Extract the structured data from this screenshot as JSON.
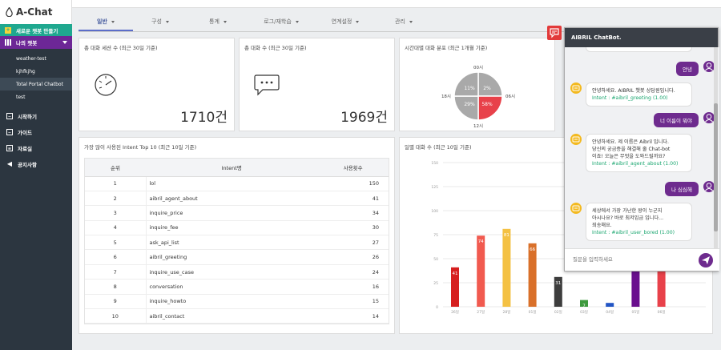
{
  "app": {
    "title": "A-Chat"
  },
  "sidebar": {
    "new_bot": "새로운 챗봇 만들기",
    "my_bots": "나의 챗봇",
    "bots": [
      "weather-test",
      "kjhfkjhg",
      "Total Portal Chatbot",
      "test"
    ],
    "nav": [
      {
        "label": "시작하기",
        "icon": "minus-box-icon"
      },
      {
        "label": "가이드",
        "icon": "minus-box-icon"
      },
      {
        "label": "자료실",
        "icon": "document-icon"
      },
      {
        "label": "공지사항",
        "icon": "megaphone-icon"
      }
    ]
  },
  "tabs": [
    "일반",
    "구성",
    "통계",
    "로그/재학습",
    "연계설정",
    "관리"
  ],
  "cards": {
    "sessions": {
      "title": "총 대화 세션 수 (최근 30일 기준)",
      "value": "1710건"
    },
    "dialogs": {
      "title": "총 대화 수 (최근 30일 기준)",
      "value": "1969건"
    },
    "time_dist": {
      "title": "시간대별 대화 분포 (최근 1개월 기준)"
    },
    "intent_top": {
      "title": "가장 많이 사용된 Intent Top 10 (최근 10일 기준)"
    },
    "daily": {
      "title": "일별 대화 수 (최근 10일 기준)"
    }
  },
  "intent_table": {
    "headers": [
      "순위",
      "Intent명",
      "사용횟수"
    ],
    "rows": [
      [
        "1",
        "lol",
        "150"
      ],
      [
        "2",
        "aibril_agent_about",
        "41"
      ],
      [
        "3",
        "inquire_price",
        "34"
      ],
      [
        "4",
        "inquire_fee",
        "30"
      ],
      [
        "5",
        "ask_api_list",
        "27"
      ],
      [
        "6",
        "aibril_greeting",
        "26"
      ],
      [
        "7",
        "inquire_use_case",
        "24"
      ],
      [
        "8",
        "conversation",
        "16"
      ],
      [
        "9",
        "inquire_howto",
        "15"
      ],
      [
        "10",
        "aibril_contact",
        "14"
      ]
    ]
  },
  "chart_data": [
    {
      "type": "pie",
      "title": "시간대별 대화 분포 (최근 1개월 기준)",
      "categories": [
        "00시-06시",
        "06시-12시",
        "12시-18시",
        "18시-00시"
      ],
      "values": [
        2,
        58,
        29,
        11
      ],
      "tick_labels": [
        "00시",
        "06시",
        "12시",
        "18시"
      ],
      "colors": [
        "#a9a9a9",
        "#e8414a",
        "#a9a9a9",
        "#a9a9a9"
      ]
    },
    {
      "type": "bar",
      "title": "일별 대화 수 (최근 10일 기준)",
      "ylim": [
        0,
        150
      ],
      "yticks": [
        0,
        25,
        50,
        75,
        100,
        125,
        150
      ],
      "categories": [
        "26일",
        "27일",
        "28일",
        "01일",
        "02일",
        "03일",
        "04일",
        "05일",
        "06일"
      ],
      "values": [
        41,
        74,
        81,
        66,
        31,
        7,
        4,
        40,
        42
      ],
      "colors": [
        "#d61f1f",
        "#f15a4f",
        "#f4c143",
        "#d9702a",
        "#3d3d3d",
        "#3d9a3d",
        "#2255c4",
        "#6a0f8e",
        "#e8414a"
      ],
      "data_labels": [
        "41",
        "74",
        "81",
        "66",
        "31",
        "7",
        "",
        "",
        ""
      ]
    }
  ],
  "chatbot": {
    "title": "AIBRIL ChatBot.",
    "input_placeholder": "질문을 입력하세요",
    "messages": [
      {
        "from": "user",
        "text": "안녕"
      },
      {
        "from": "bot",
        "lines": [
          "안녕하세요. AIBRIL 챗봇 상담원입니다."
        ],
        "intent": "Intent : #aibril_greeting (1.00)"
      },
      {
        "from": "user",
        "text": "너 이름이 뭐야"
      },
      {
        "from": "bot",
        "lines": [
          "안녕하세요. 제 이름은 Aibril 입니다.",
          "당신의 궁금증을 해결해 줄 Chat-bot",
          "이죠! 오늘은 무엇을 도와드릴까요?"
        ],
        "intent": "Intent : #aibril_agent_about (1.00)"
      },
      {
        "from": "user",
        "text": "나 심심해"
      },
      {
        "from": "bot",
        "lines": [
          "세상에서 가장 가난한 왕이 누군지",
          "아시나요? 바로 최저임금 입니다...",
          "죄송해요."
        ],
        "intent": "Intent : #aibril_user_bored (1.00)"
      }
    ]
  }
}
